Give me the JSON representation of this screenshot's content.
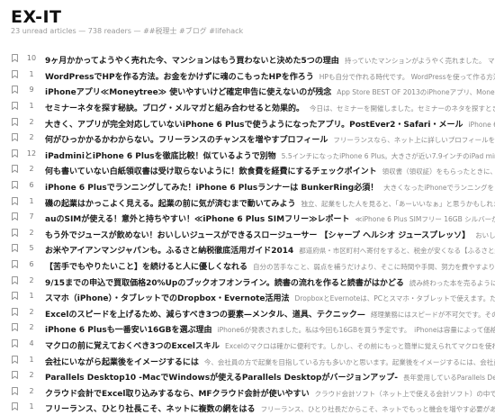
{
  "header": {
    "title": "EX-IT",
    "meta": "23 unread articles — 738 readers — ##税理士 #ブログ #lifehack"
  },
  "icons": {
    "bookmark": "bookmark-icon",
    "color": "#888888"
  },
  "items": [
    {
      "count": "10",
      "title": "9ヶ月かかってようやく売れた今、マンションはもう買わないと決めた5つの理由",
      "snippet": "持っていたマンションがようやく売れました。 マンションはもう"
    },
    {
      "count": "1",
      "title": "WordPressでHPを作る方法。お金をかけずに魂のこもったHPを作ろう",
      "snippet": "HPも自分で作れる時代です。 WordPressを使って作る方法を解説します"
    },
    {
      "count": "9",
      "title": "iPhoneアプリ≪Moneytree≫ 使いやすいけど確定申告に使えないのが残念",
      "snippet": "App Store BEST OF 2013のiPhoneアプリ、MoneyTree。"
    },
    {
      "count": "1",
      "title": "セミナーネタを探す秘訣。ブログ・メルマガと組み合わせると効果的。",
      "snippet": "今日は、セミナーを開催しました。セミナーのネタを探すときに気をつけて"
    },
    {
      "count": "2",
      "title": "大きく、アプリが完全対応していないiPhone 6 Plusで使うようになったアプリ。PostEver2・Safari・メール",
      "snippet": "iPhone 6 Plusを使って1週間"
    },
    {
      "count": "2",
      "title": "何がひっかかるかわからない。フリーランスのチャンスを増やすプロフィール",
      "snippet": "フリーランスなら、ネット上に詳しいプロフィールを書いておくこと"
    },
    {
      "count": "12",
      "title": "iPadminiとiPhone 6 Plusを徹底比較！似ているようで別物",
      "snippet": "5.5インチになったiPhone 6 Plus。大きさが近い7.9インチのiPad mini Retinaディスプレイ"
    },
    {
      "count": "2",
      "title": "何も書いていない白紙領収書は受け取らないように！飲食費を経費にするチェックポイント",
      "snippet": "領収書（領収証）をもらったときに、もし白紙だったら"
    },
    {
      "count": "6",
      "title": "iPhone 6 Plusでランニングしてみた！iPhone 6 Plusランナーは BunkerRing必須！",
      "snippet": "大きくなったiPhoneでランニングをしてみました"
    },
    {
      "count": "1",
      "title": "磯の起業はかっこよく見える。起業の前に気が済むまで動いてみよう",
      "snippet": "独立、起業をした人を見ると、「あーいいなぁ」と思うかもしれません。ただ"
    },
    {
      "count": "7",
      "title": "auのSIMが使える！意外と持ちやすい！≪iPhone 6 Plus SIMフリー≫レポート",
      "snippet": "≪iPhone 6 Plus SIMフリー 16GB シルバーが届いたので、見た"
    },
    {
      "count": "2",
      "title": "もう外でジュースが飲めない！おいしいジュースができるスロージューサー 【シャープ ヘルシオ ジュースプレッソ】",
      "snippet": "おいしいフルーツジュースを"
    },
    {
      "count": "5",
      "title": "お米やアイアンマンジャパンも。ふるさと納税徹底活用ガイド2014",
      "snippet": "都道府県・市区町村へ寄付をすると、税金が安くなる【ふるさと納税】。自治体"
    },
    {
      "count": "6",
      "title": "【苦手でもやりたいこと】を続けると人に優しくなれる",
      "snippet": "自分の苦手なこと、弱点を補うだけより、そこに時間や手間、努力を費やすより自分の強みを"
    },
    {
      "count": "2",
      "title": "9/15までの申込で買取価格20%Upのブックオフオンライン。読書の流れを作ると読書がはかどる",
      "snippet": "読み終わった本を売るようにすると、読書が流"
    },
    {
      "count": "1",
      "title": "スマホ（iPhone）・タブレットでのDropbox・Evernote活用法",
      "snippet": "DropboxとEvernoteは、PCとスマホ・タブレットで使えます。ただし、PCで使"
    },
    {
      "count": "2",
      "title": "Excelのスピードを上げるため、減らすべき3つの要素—メンタル、道具、テクニック—",
      "snippet": "経理業務にはスピードが不可欠です。そのスピードを上げるため"
    },
    {
      "count": "2",
      "title": "iPhone 6 Plusも一番安い16GBを選ぶ理由",
      "snippet": "iPhone6が発表されました。私は今回も16GBを買う予定です。　iPhoneは容量によって価格が違う iPhone"
    },
    {
      "count": "4",
      "title": "マクロの前に覚えておくべき3つのExcelスキル",
      "snippet": "Excelのマクロは確かに便利です。しかし、その前にもっと簡単に覚えられてマクロを使わずにすむ方"
    },
    {
      "count": "1",
      "title": "会社にいながら起業後をイメージするには",
      "snippet": "今、会社員の方で起業を目指している方も多いかと思います。起業後をイメージするには、会社員"
    },
    {
      "count": "2",
      "title": "Parallels Desktop10 -MacでWindowsが使えるParallels Desktopがバージョンアップ-",
      "snippet": "長年愛用しているParallels Desktopがアップデート"
    },
    {
      "count": "2",
      "title": "クラウド会計でExcel取り込みするなら、MFクラウド会計が使いやすい",
      "snippet": "クラウド会計ソフト（ネット上で使える会計ソフト）の中で、Excelとの連携"
    },
    {
      "count": "1",
      "title": "フリーランス、ひとり社長こそ、ネットに複数の網をはる",
      "snippet": "フリーランス、ひとり社長だからこそ、ネットでもっと機会を増やす必要がある"
    }
  ]
}
